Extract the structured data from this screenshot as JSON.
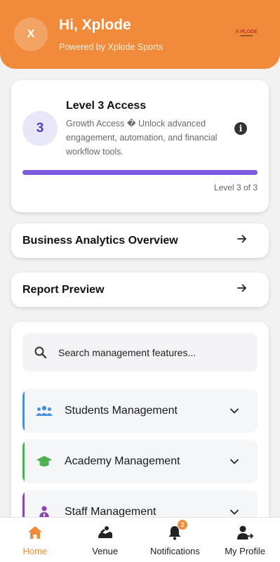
{
  "header": {
    "avatar_initial": "X",
    "greeting": "Hi, Xplode",
    "powered_by": "Powered by Xplode Sports",
    "logo_text": "X-PLODE",
    "bg_color": "#ef8b3a"
  },
  "level": {
    "number": "3",
    "title": "Level 3 Access",
    "description": "Growth Access � Unlock advanced engagement, automation, and financial workflow tools.",
    "progress_fraction": 1.0,
    "progress_label": "Level 3 of 3",
    "accent": "#7b5ce0"
  },
  "links": [
    {
      "title": "Business Analytics Overview"
    },
    {
      "title": "Report Preview"
    }
  ],
  "search": {
    "placeholder": "Search management features..."
  },
  "management": [
    {
      "label": "Students Management",
      "icon": "students-icon",
      "accent": "#4a90d9"
    },
    {
      "label": "Academy Management",
      "icon": "graduation-cap-icon",
      "accent": "#4caf50"
    },
    {
      "label": "Staff Management",
      "icon": "staff-icon",
      "accent": "#8e44ad"
    }
  ],
  "nav": [
    {
      "label": "Home",
      "icon": "home-icon",
      "active": true
    },
    {
      "label": "Venue",
      "icon": "venue-icon"
    },
    {
      "label": "Notifications",
      "icon": "bell-icon",
      "badge": "2"
    },
    {
      "label": "My Profile",
      "icon": "profile-icon"
    }
  ]
}
